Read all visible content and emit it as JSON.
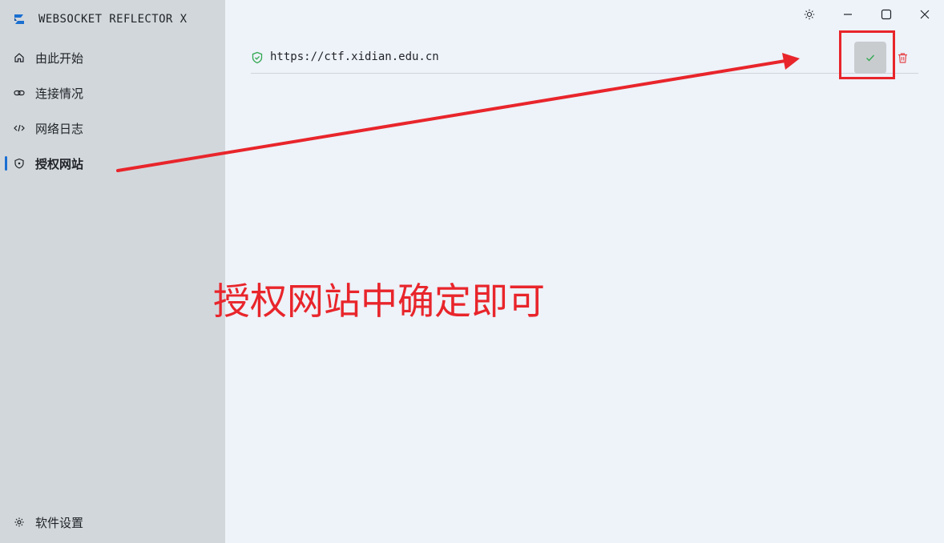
{
  "app": {
    "title": "WEBSOCKET REFLECTOR X"
  },
  "sidebar": {
    "items": [
      {
        "label": "由此开始",
        "icon": "home-icon"
      },
      {
        "label": "连接情况",
        "icon": "link-icon"
      },
      {
        "label": "网络日志",
        "icon": "code-icon"
      },
      {
        "label": "授权网站",
        "icon": "shield-icon",
        "active": true
      }
    ],
    "settings": {
      "label": "软件设置",
      "icon": "gear-icon"
    }
  },
  "window_controls": {
    "theme": "sun-icon",
    "minimize": "minimize-icon",
    "maximize": "maximize-icon",
    "close": "close-icon"
  },
  "sites": [
    {
      "url": "https://ctf.xidian.edu.cn",
      "status_icon": "shield-check-icon"
    }
  ],
  "annotation": {
    "text": "授权网站中确定即可"
  },
  "colors": {
    "accent": "#1a6fd1",
    "sidebar_bg": "#d2d7dc",
    "content_bg": "#eef2f9",
    "annotation_red": "#e8252b",
    "success_green": "#2fa84f",
    "danger_red": "#e5484d"
  }
}
